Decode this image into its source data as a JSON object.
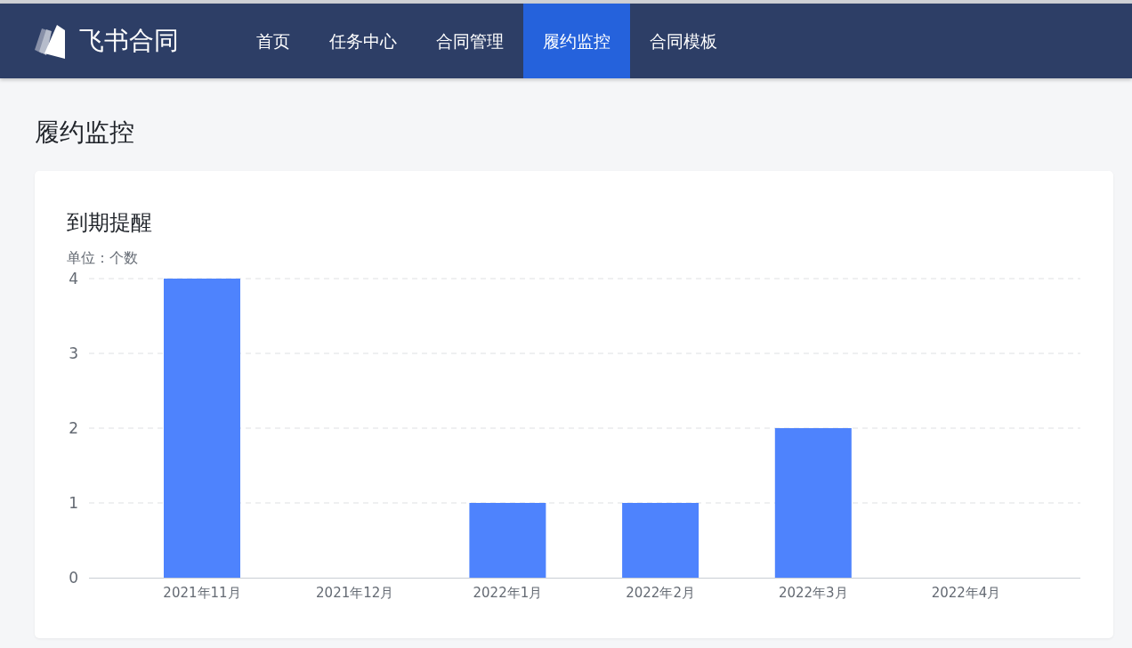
{
  "app": {
    "name": "飞书合同"
  },
  "nav": [
    {
      "label": "首页",
      "selected": false
    },
    {
      "label": "任务中心",
      "selected": false
    },
    {
      "label": "合同管理",
      "selected": false
    },
    {
      "label": "履约监控",
      "selected": true
    },
    {
      "label": "合同模板",
      "selected": false
    }
  ],
  "page_title": "履约监控",
  "card": {
    "title": "到期提醒",
    "unit": "单位：个数",
    "chart_data": {
      "type": "bar",
      "categories": [
        "2021年11月",
        "2021年12月",
        "2022年1月",
        "2022年2月",
        "2022年3月",
        "2022年4月"
      ],
      "series": [
        {
          "color": "#4e83fd",
          "values": [
            4,
            0,
            1,
            1,
            2,
            0
          ]
        }
      ],
      "grid": true,
      "ylim": [
        0,
        4
      ],
      "yticks": [
        0,
        1,
        2,
        3,
        4
      ]
    }
  }
}
